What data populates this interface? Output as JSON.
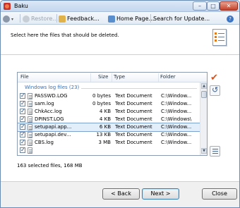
{
  "window": {
    "title": "Baku"
  },
  "title_buttons": {
    "minimize": "–",
    "maximize": "□",
    "close": "✕"
  },
  "toolbar": {
    "restore": "Restore...",
    "feedback": "Feedback...",
    "homepage": "Home Page...",
    "updates": "Search for Update..."
  },
  "header": {
    "instruction": "Select here the files that should be deleted."
  },
  "list": {
    "columns": {
      "file": "File",
      "size": "Size",
      "type": "Type",
      "folder": "Folder"
    },
    "group": "Windows log files (23)",
    "rows": [
      {
        "name": "PASSWD.LOG",
        "size": "0 bytes",
        "type": "Text Document",
        "folder": "C:\\Window..."
      },
      {
        "name": "sam.log",
        "size": "0 bytes",
        "type": "Text Document",
        "folder": "C:\\Window..."
      },
      {
        "name": "ChkAcc.log",
        "size": "4 KB",
        "type": "Text Document",
        "folder": "C:\\Window..."
      },
      {
        "name": "DPINST.LOG",
        "size": "4 KB",
        "type": "Text Document",
        "folder": "C:\\Windows\\"
      },
      {
        "name": "setupapi.app...",
        "size": "6 KB",
        "type": "Text Document",
        "folder": "C:\\Window..."
      },
      {
        "name": "setupapi.dev...",
        "size": "13 KB",
        "type": "Text Document",
        "folder": "C:\\Window..."
      },
      {
        "name": "CBS.log",
        "size": "3 MB",
        "type": "Text Document",
        "folder": "C:\\Window..."
      },
      {
        "name": "",
        "size": "",
        "type": "",
        "folder": ""
      }
    ]
  },
  "status": {
    "summary": "163 selected files, 168 MB"
  },
  "buttons": {
    "back": "< Back",
    "next": "Next >",
    "close": "Close"
  },
  "colors": {
    "accent": "#3b6fb6",
    "selection": "#e3eefb",
    "check": "#d9531e"
  }
}
